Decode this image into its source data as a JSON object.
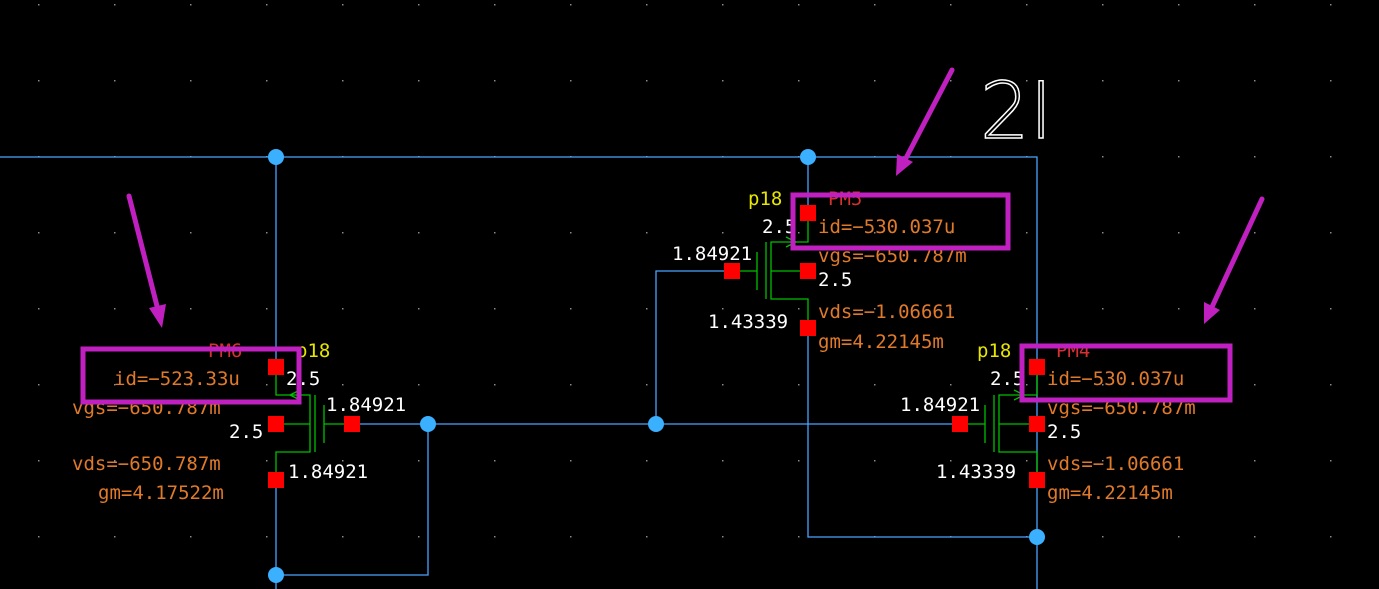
{
  "title_text": "2I",
  "colors": {
    "background": "#000000",
    "wire": "#4aa3ff",
    "device": "#00c000",
    "pin": "#ff0000",
    "highlight": "#c020c0",
    "param": "#e07a2a",
    "voltage": "#ffffff",
    "model": "#e6e600",
    "instance": "#d63030"
  },
  "devices": {
    "pm6": {
      "name": "PM6",
      "model": "p18",
      "id": "id=−523.33u",
      "vgs": "vgs=−650.787m",
      "vds": "vds=−650.787m",
      "gm": "gm=4.17522m",
      "v_source": "2.5",
      "v_bulk": "2.5",
      "v_gate": "1.84921",
      "v_drain": "1.84921"
    },
    "pm5": {
      "name": "PM5",
      "model": "p18",
      "id": "id=−530.037u",
      "vgs": "vgs=−650.787m",
      "vds": "vds=−1.06661",
      "gm": "gm=4.22145m",
      "v_source": "2.5",
      "v_bulk": "2.5",
      "v_gate": "1.84921",
      "v_drain": "1.43339"
    },
    "pm4": {
      "name": "PM4",
      "model": "p18",
      "id": "id=−530.037u",
      "vgs": "vgs=−650.787m",
      "vds": "vds=−1.06661",
      "gm": "gm=4.22145m",
      "v_source": "2.5",
      "v_bulk": "2.5",
      "v_gate": "1.84921",
      "v_drain": "1.43339"
    }
  }
}
